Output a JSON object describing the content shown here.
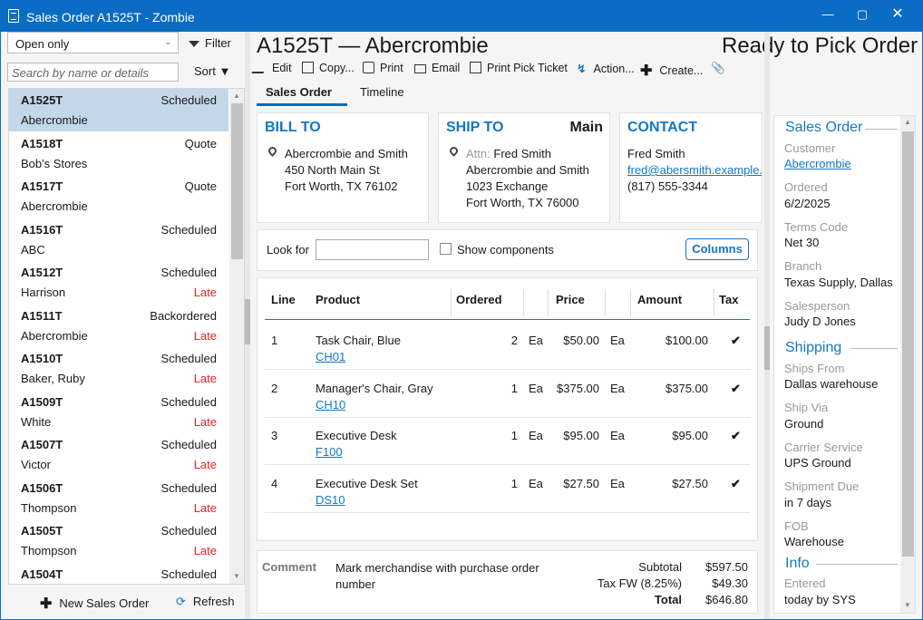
{
  "window": {
    "title": "Sales Order A1525T - Zombie"
  },
  "left": {
    "filter_select": "Open only",
    "filter_label": "Filter",
    "search_placeholder": "Search by name or details",
    "sort_label": "Sort",
    "orders": [
      {
        "num": "A1525T",
        "status": "Scheduled",
        "customer": "Abercrombie",
        "late": "",
        "selected": true
      },
      {
        "num": "A1518T",
        "status": "Quote",
        "customer": "Bob's Stores",
        "late": ""
      },
      {
        "num": "A1517T",
        "status": "Quote",
        "customer": "Abercrombie",
        "late": ""
      },
      {
        "num": "A1516T",
        "status": "Scheduled",
        "customer": "ABC",
        "late": ""
      },
      {
        "num": "A1512T",
        "status": "Scheduled",
        "customer": "Harrison",
        "late": "Late"
      },
      {
        "num": "A1511T",
        "status": "Backordered",
        "customer": "Abercrombie",
        "late": "Late"
      },
      {
        "num": "A1510T",
        "status": "Scheduled",
        "customer": "Baker, Ruby",
        "late": "Late"
      },
      {
        "num": "A1509T",
        "status": "Scheduled",
        "customer": "White",
        "late": "Late"
      },
      {
        "num": "A1507T",
        "status": "Scheduled",
        "customer": "Victor",
        "late": "Late"
      },
      {
        "num": "A1506T",
        "status": "Scheduled",
        "customer": "Thompson",
        "late": "Late"
      },
      {
        "num": "A1505T",
        "status": "Scheduled",
        "customer": "Thompson",
        "late": "Late"
      },
      {
        "num": "A1504T",
        "status": "Scheduled",
        "customer": "",
        "late": ""
      }
    ],
    "new_label": "New Sales Order",
    "refresh_label": "Refresh"
  },
  "main": {
    "title": "A1525T — Abercrombie",
    "status": "Ready to Pick Order",
    "toolbar": [
      "Edit",
      "Copy...",
      "Print",
      "Email",
      "Print Pick Ticket",
      "Action...",
      "Create..."
    ],
    "tabs": [
      "Sales Order",
      "Timeline"
    ],
    "bill_to": {
      "title": "BILL TO",
      "lines": [
        "Abercrombie and Smith",
        "450 North Main St",
        "Fort Worth, TX  76102"
      ]
    },
    "ship_to": {
      "title": "SHIP TO",
      "tag": "Main",
      "attn_label": "Attn:",
      "attn": "Fred Smith",
      "lines": [
        "Abercrombie and Smith",
        "1023 Exchange",
        "Fort Worth, TX  76000"
      ]
    },
    "contact": {
      "title": "CONTACT",
      "name": "Fred Smith",
      "email": "fred@abersmith.example.",
      "phone": "(817) 555-3344"
    },
    "look_for": "Look for",
    "show_components": "Show components",
    "columns_btn": "Columns",
    "headers": [
      "Line",
      "Product",
      "Ordered",
      "Price",
      "Amount",
      "Tax"
    ],
    "lines": [
      {
        "line": "1",
        "product": "Task Chair, Blue",
        "code": "CH01",
        "qty": "2",
        "uom": "Ea",
        "price": "$50.00",
        "puom": "Ea",
        "amount": "$100.00"
      },
      {
        "line": "2",
        "product": "Manager's Chair, Gray",
        "code": "CH10",
        "qty": "1",
        "uom": "Ea",
        "price": "$375.00",
        "puom": "Ea",
        "amount": "$375.00"
      },
      {
        "line": "3",
        "product": "Executive Desk",
        "code": "F100",
        "qty": "1",
        "uom": "Ea",
        "price": "$95.00",
        "puom": "Ea",
        "amount": "$95.00"
      },
      {
        "line": "4",
        "product": "Executive Desk Set",
        "code": "DS10",
        "qty": "1",
        "uom": "Ea",
        "price": "$27.50",
        "puom": "Ea",
        "amount": "$27.50"
      }
    ],
    "comment_label": "Comment",
    "comment": "Mark merchandise with purchase order number",
    "subtotal_label": "Subtotal",
    "subtotal": "$597.50",
    "tax_label": "Tax FW (8.25%)",
    "tax": "$49.30",
    "total_label": "Total",
    "total": "$646.80"
  },
  "right": {
    "sales_order": "Sales Order",
    "customer_l": "Customer",
    "customer_v": "Abercrombie",
    "ordered_l": "Ordered",
    "ordered_v": "6/2/2025",
    "terms_l": "Terms Code",
    "terms_v": "Net 30",
    "branch_l": "Branch",
    "branch_v": "Texas Supply, Dallas",
    "sales_l": "Salesperson",
    "sales_v": "Judy D Jones",
    "shipping": "Shipping",
    "from_l": "Ships From",
    "from_v": "Dallas warehouse",
    "via_l": "Ship Via",
    "via_v": "Ground",
    "carrier_l": "Carrier Service",
    "carrier_v": "UPS Ground",
    "due_l": "Shipment Due",
    "due_v": "in 7 days",
    "fob_l": "FOB",
    "fob_v": "Warehouse",
    "info": "Info",
    "entered_l": "Entered",
    "entered_v": "today by SYS"
  }
}
